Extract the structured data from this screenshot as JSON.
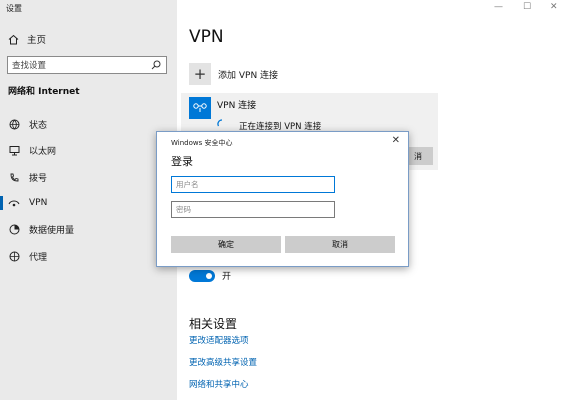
{
  "window": {
    "title": "设置"
  },
  "sidebar": {
    "home": "主页",
    "search_placeholder": "查找设置",
    "section": "网络和 Internet",
    "items": [
      {
        "label": "状态",
        "icon": "globe-status-icon"
      },
      {
        "label": "以太网",
        "icon": "monitor-ethernet-icon"
      },
      {
        "label": "拨号",
        "icon": "phone-dialup-icon"
      },
      {
        "label": "VPN",
        "icon": "vpn-icon",
        "active": true
      },
      {
        "label": "数据使用量",
        "icon": "data-usage-icon"
      },
      {
        "label": "代理",
        "icon": "globe-proxy-icon"
      }
    ]
  },
  "main": {
    "title": "VPN",
    "add_vpn": "添加 VPN 连接",
    "connection": {
      "name": "VPN 连接",
      "status": "正在连接到 VPN 连接",
      "button_partial": "消"
    },
    "toggle_label": "开",
    "related_title": "相关设置",
    "links": [
      "更改适配器选项",
      "更改高级共享设置",
      "网络和共享中心"
    ]
  },
  "dialog": {
    "title": "Windows 安全中心",
    "heading": "登录",
    "username_placeholder": "用户名",
    "password_placeholder": "密码",
    "ok": "确定",
    "cancel": "取消"
  },
  "colors": {
    "accent": "#0078d7",
    "link": "#0063b1",
    "sidebar_bg": "#eaeaea"
  }
}
